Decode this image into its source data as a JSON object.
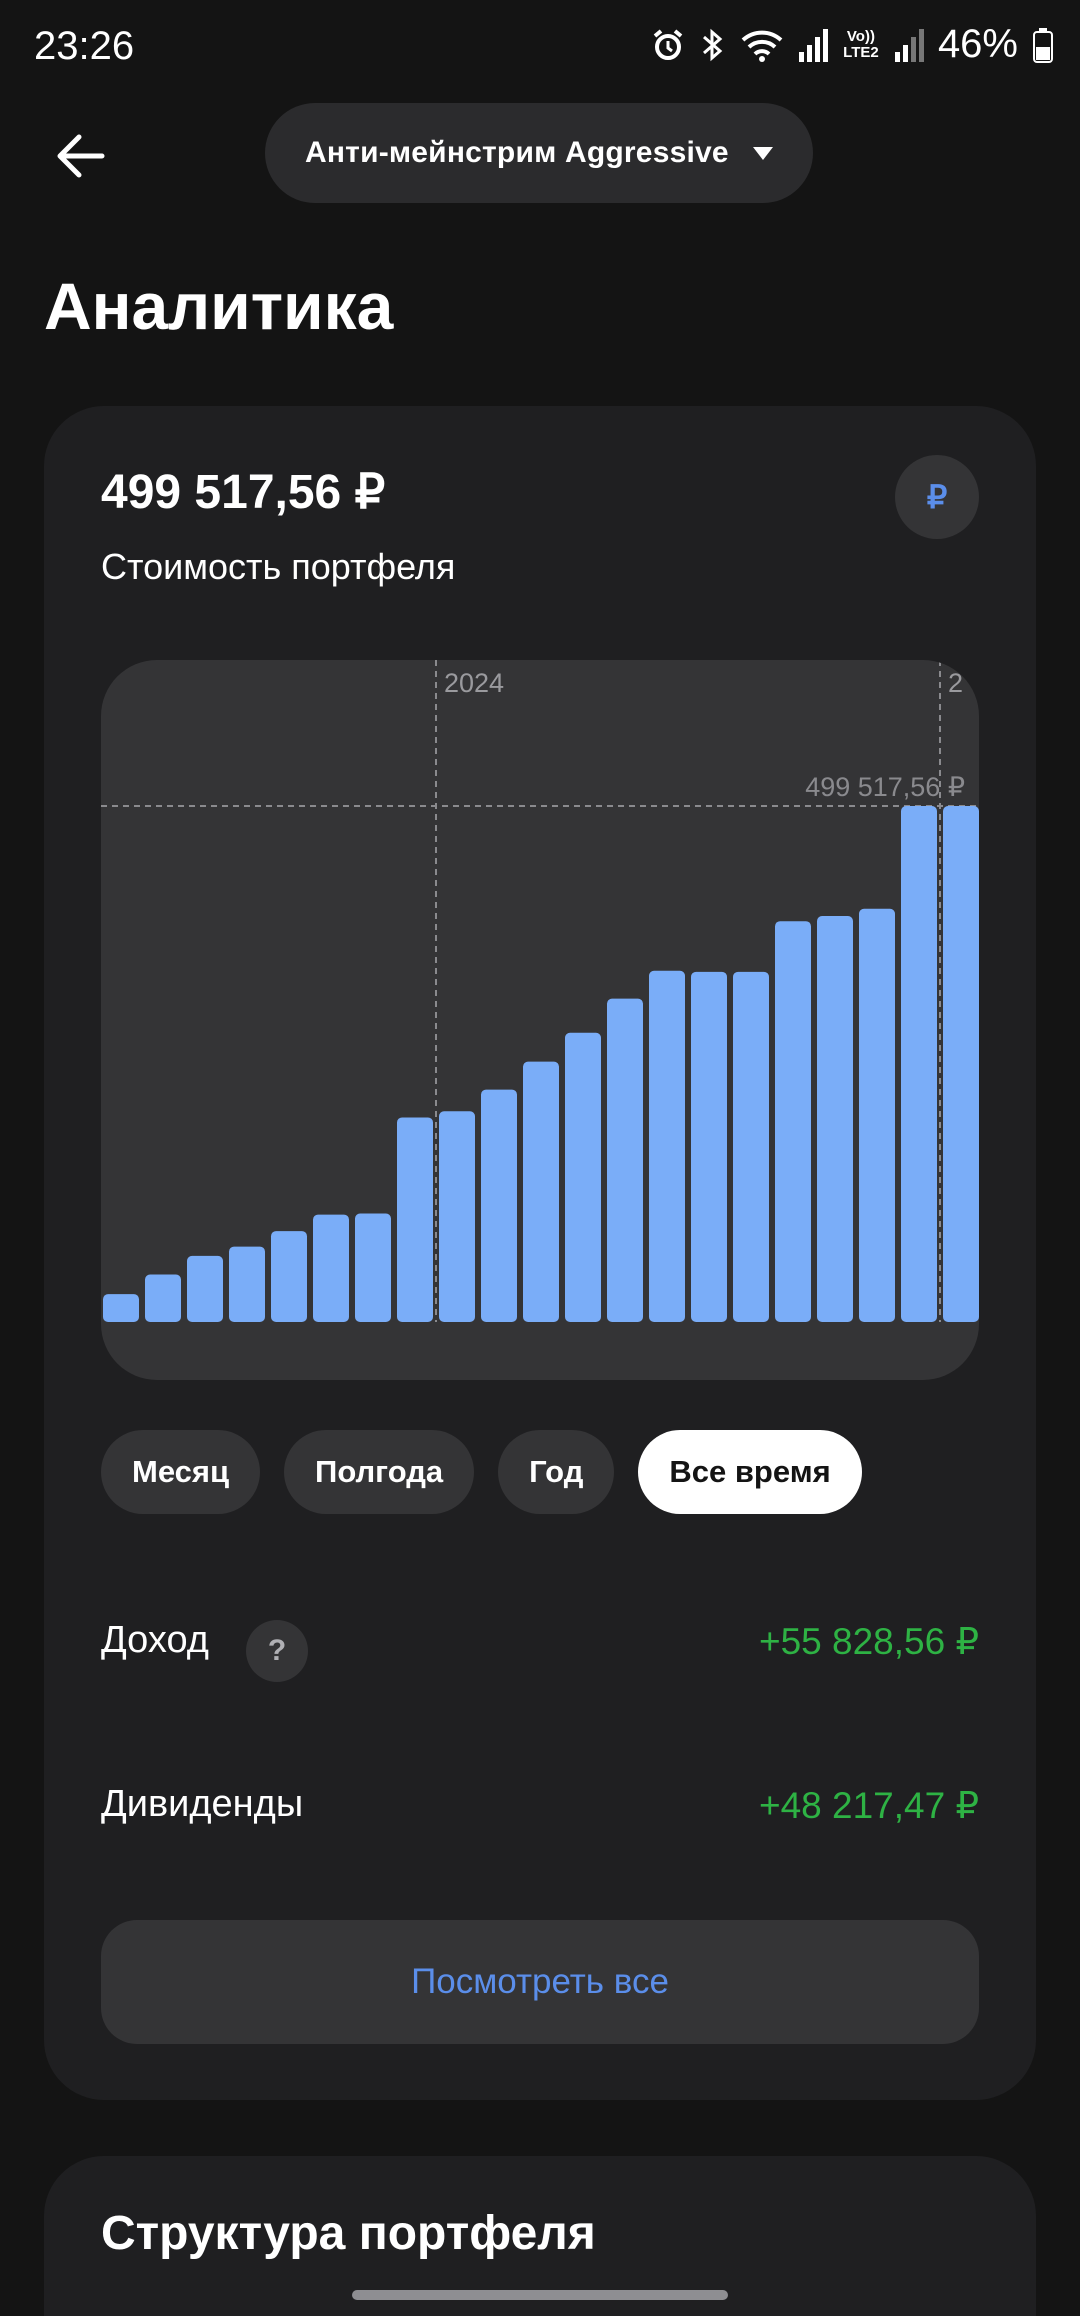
{
  "status_bar": {
    "time": "23:26",
    "battery_text": "46%",
    "network_label": "Vo)) LTE2",
    "icons": [
      "alarm-icon",
      "bluetooth-icon",
      "wifi-icon",
      "signal-icon",
      "signal-icon",
      "battery-icon"
    ]
  },
  "header": {
    "portfolio_name": "Анти-мейнстрим Aggressive",
    "title": "Аналитика"
  },
  "summary": {
    "value": "499 517,56 ₽",
    "label": "Стоимость портфеля",
    "currency_symbol": "₽"
  },
  "chart_data": {
    "type": "bar",
    "title": "",
    "xlabel": "",
    "ylabel": "",
    "year_markers": [
      {
        "label": "2024",
        "after_bar": 8
      },
      {
        "label": "2",
        "after_bar": 20
      }
    ],
    "max_label": "499 517,56 ₽",
    "values": [
      27000,
      46000,
      64000,
      73000,
      88000,
      104000,
      105000,
      198000,
      204000,
      225000,
      252000,
      280000,
      313000,
      340000,
      339000,
      339000,
      388000,
      393000,
      400000,
      499517.56,
      499517.56
    ],
    "ylim": [
      0,
      499517.56
    ],
    "bar_color": "#7aadf8",
    "grid": false
  },
  "periods": [
    {
      "label": "Месяц",
      "active": false
    },
    {
      "label": "Полгода",
      "active": false
    },
    {
      "label": "Год",
      "active": false
    },
    {
      "label": "Все время",
      "active": true
    }
  ],
  "metrics": {
    "income_label": "Доход",
    "income_value": "+55 828,56 ₽",
    "help_symbol": "?",
    "dividends_label": "Дивиденды",
    "dividends_value": "+48 217,47 ₽"
  },
  "view_all_label": "Посмотреть все",
  "structure_title": "Структура портфеля",
  "colors": {
    "background": "#141414",
    "card": "#1f1f21",
    "accent": "#5b8eea",
    "positive": "#2eb244"
  }
}
